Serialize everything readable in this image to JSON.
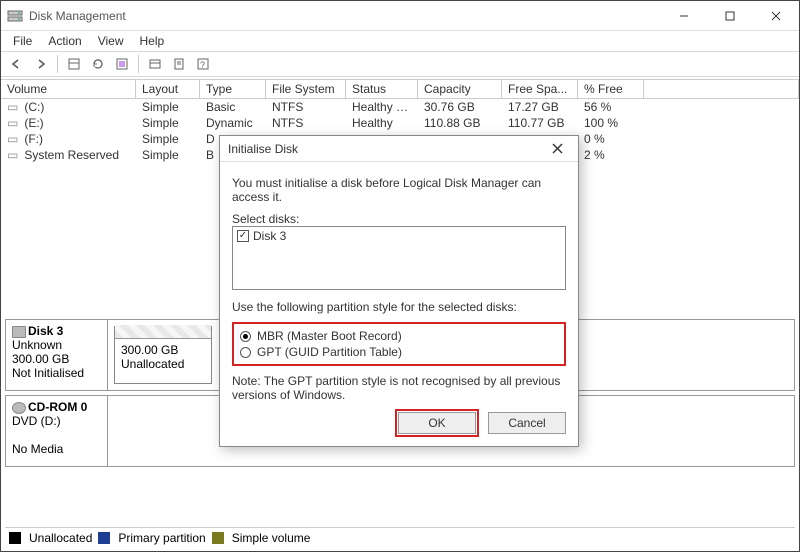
{
  "window": {
    "title": "Disk Management",
    "menu": [
      "File",
      "Action",
      "View",
      "Help"
    ]
  },
  "columns": [
    "Volume",
    "Layout",
    "Type",
    "File System",
    "Status",
    "Capacity",
    "Free Spa...",
    "% Free"
  ],
  "volumes": [
    {
      "name": "(C:)",
      "layout": "Simple",
      "type": "Basic",
      "fs": "NTFS",
      "status": "Healthy (B...",
      "capacity": "30.76 GB",
      "free": "17.27 GB",
      "pct": "56 %"
    },
    {
      "name": "(E:)",
      "layout": "Simple",
      "type": "Dynamic",
      "fs": "NTFS",
      "status": "Healthy",
      "capacity": "110.88 GB",
      "free": "110.77 GB",
      "pct": "100 %"
    },
    {
      "name": "(F:)",
      "layout": "Simple",
      "type": "D",
      "fs": "",
      "status": "",
      "capacity": "",
      "free": "",
      "pct": "0 %"
    },
    {
      "name": "System Reserved",
      "layout": "Simple",
      "type": "B",
      "fs": "",
      "status": "",
      "capacity": "",
      "free": "",
      "pct": "2 %"
    }
  ],
  "disks": {
    "d3": {
      "title": "Disk 3",
      "line1": "Unknown",
      "line2": "300.00 GB",
      "line3": "Not Initialised",
      "part_size": "300.00 GB",
      "part_state": "Unallocated"
    },
    "cd": {
      "title": "CD-ROM 0",
      "line1": "DVD (D:)",
      "line2": "",
      "line3": "No Media"
    }
  },
  "legend": {
    "unallocated": {
      "label": "Unallocated",
      "color": "#000000"
    },
    "primary": {
      "label": "Primary partition",
      "color": "#1c3f94"
    },
    "simple": {
      "label": "Simple volume",
      "color": "#7a7a1f"
    }
  },
  "dialog": {
    "title": "Initialise Disk",
    "instruction": "You must initialise a disk before Logical Disk Manager can access it.",
    "select_label": "Select disks:",
    "disk_item": "Disk 3",
    "style_label": "Use the following partition style for the selected disks:",
    "opt_mbr": "MBR (Master Boot Record)",
    "opt_gpt": "GPT (GUID Partition Table)",
    "note": "Note: The GPT partition style is not recognised by all previous versions of Windows.",
    "ok": "OK",
    "cancel": "Cancel"
  }
}
